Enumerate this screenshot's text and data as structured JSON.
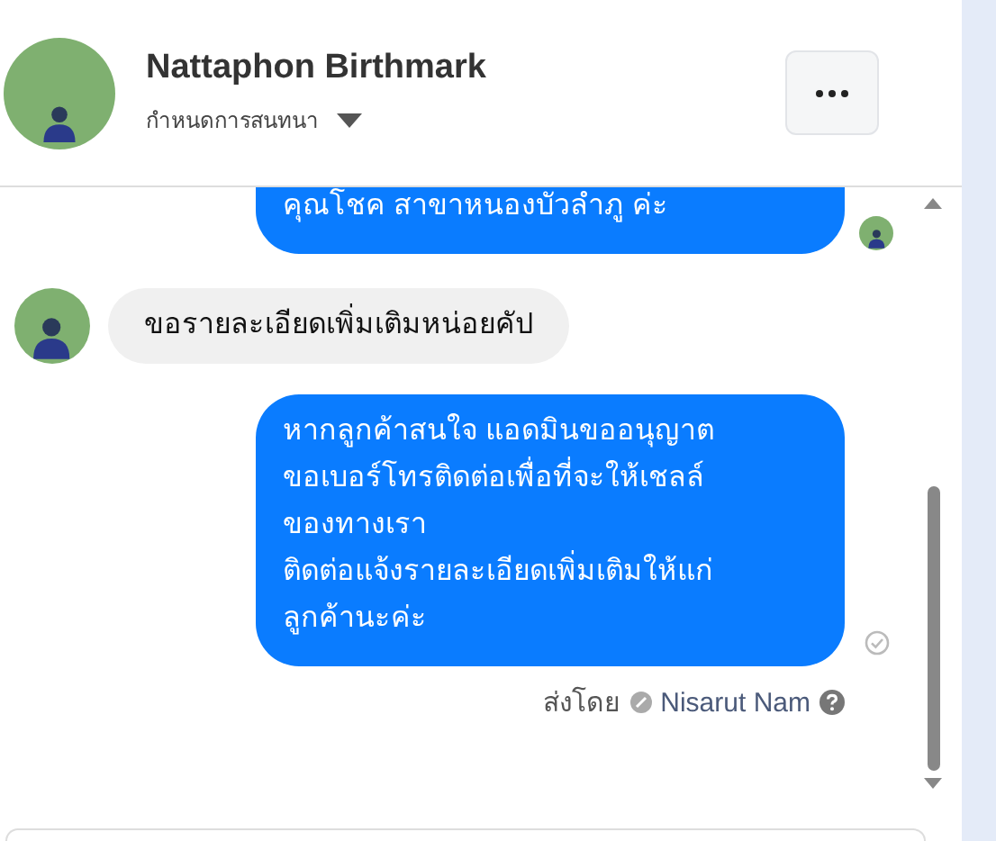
{
  "header": {
    "name": "Nattaphon Birthmark",
    "subtitle": "กำหนดการสนทนา"
  },
  "messages": [
    {
      "kind": "outgoing",
      "text": "คุณโชค สาขาหนองบัวลำภู ค่ะ",
      "seen": true
    },
    {
      "kind": "incoming",
      "text": "ขอรายละเอียดเพิ่มเติมหน่อยคัป"
    },
    {
      "kind": "outgoing",
      "text": "หากลูกค้าสนใจ แอดมินขออนุญาต\nขอเบอร์โทรติดต่อเพื่อที่จะให้เชลล์\nของทางเรา\nติดต่อแจ้งรายละเอียดเพิ่มเติมให้แก่\nลูกค้านะค่ะ",
      "seen": false
    }
  ],
  "sent_by": {
    "label": "ส่งโดย",
    "sender": "Nisarut Nam"
  }
}
